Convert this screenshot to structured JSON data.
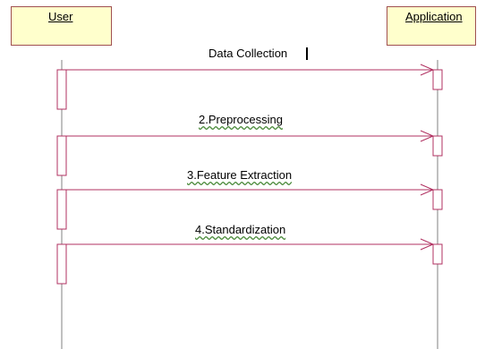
{
  "lifelines": [
    {
      "id": "user",
      "label": "User"
    },
    {
      "id": "app",
      "label": "Application"
    }
  ],
  "messages": [
    {
      "label": "Data Collection",
      "from": "User",
      "to": "Application"
    },
    {
      "label": "2.Preprocessing",
      "from": "User",
      "to": "Application"
    },
    {
      "label": "3.Feature  Extraction",
      "from": "User",
      "to": "Application"
    },
    {
      "label": "4.Standardization",
      "from": "User",
      "to": "Application"
    }
  ],
  "colors": {
    "actor_fill": "#ffffcc",
    "actor_border": "#a05050",
    "lifeline": "#808080",
    "message": "#b03060",
    "activation_border": "#b03060"
  }
}
